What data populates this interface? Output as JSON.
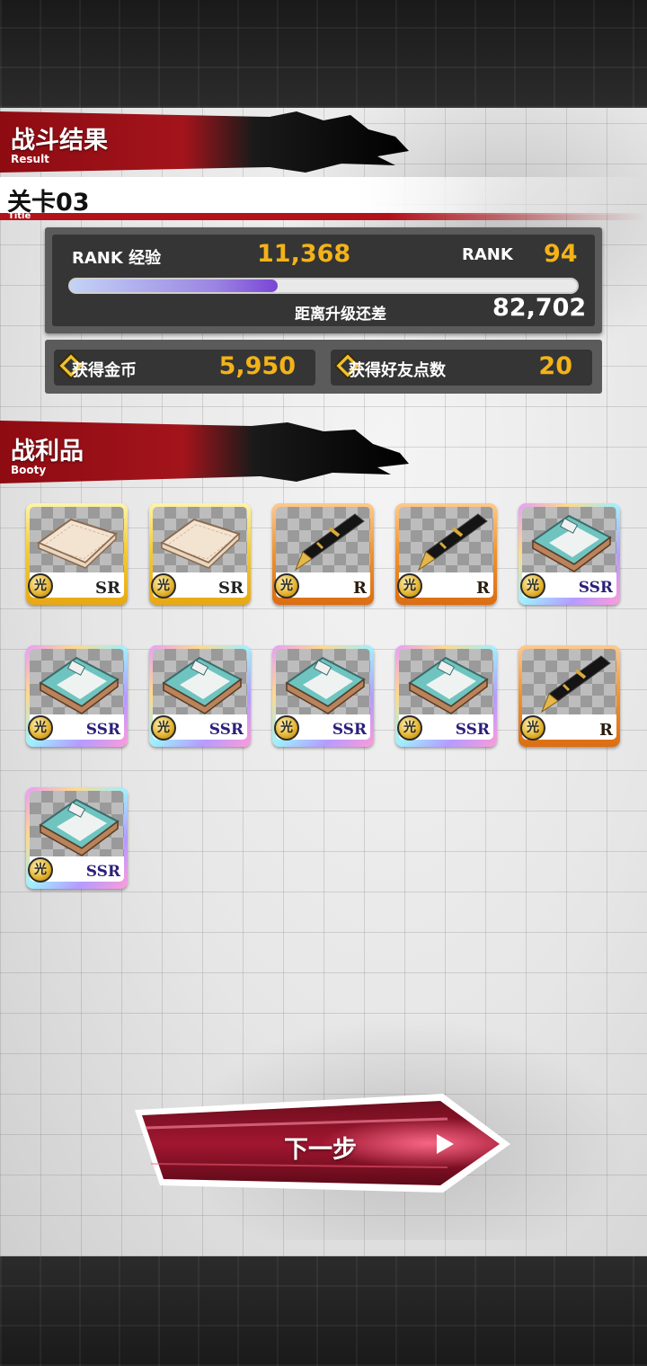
{
  "header": {
    "section_title": "战斗结果",
    "section_subtitle": "Result",
    "stage_name": "关卡03",
    "stage_label": "Title"
  },
  "rank": {
    "exp_label": "RANK 经验",
    "exp_value": "11,368",
    "rank_label": "RANK",
    "rank_value": "94",
    "progress_fraction": 0.41,
    "remaining_label": "距离升级还差",
    "remaining_value": "82,702"
  },
  "rewards": {
    "gold_label": "获得金币",
    "gold_value": "5,950",
    "friend_label": "获得好友点数",
    "friend_value": "20"
  },
  "booty": {
    "title": "战利品",
    "subtitle": "Booty",
    "items": [
      {
        "type": "notebook",
        "rarity": "SR",
        "element": "光"
      },
      {
        "type": "notebook",
        "rarity": "SR",
        "element": "光"
      },
      {
        "type": "pen",
        "rarity": "R",
        "element": "光"
      },
      {
        "type": "pen",
        "rarity": "R",
        "element": "光"
      },
      {
        "type": "book",
        "rarity": "SSR",
        "element": "光"
      },
      {
        "type": "book",
        "rarity": "SSR",
        "element": "光"
      },
      {
        "type": "book",
        "rarity": "SSR",
        "element": "光"
      },
      {
        "type": "book",
        "rarity": "SSR",
        "element": "光"
      },
      {
        "type": "book",
        "rarity": "SSR",
        "element": "光"
      },
      {
        "type": "pen",
        "rarity": "R",
        "element": "光"
      },
      {
        "type": "book",
        "rarity": "SSR",
        "element": "光"
      }
    ]
  },
  "next_button": {
    "label": "下一步"
  },
  "colors": {
    "accent_red": "#b3121b",
    "gold_text": "#f3b318",
    "panel_dark": "#353535"
  }
}
